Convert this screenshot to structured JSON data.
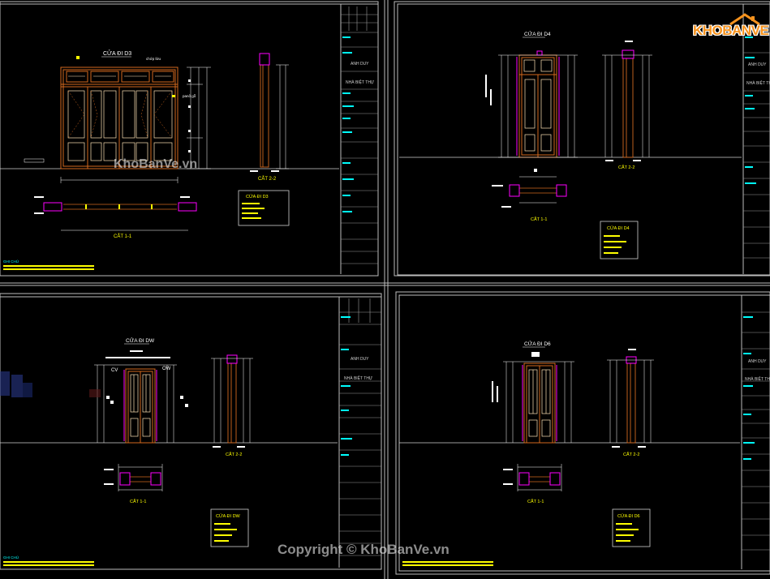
{
  "watermark": {
    "logo_text": "KHOBANVE",
    "center_text": "KhoBanVe.vn",
    "copyright_text": "Copyright © KhoBanVe.vn"
  },
  "title_block": {
    "owner": "ANH DUY",
    "project": "NHÀ BIỆT THỰ"
  },
  "sheets": [
    {
      "id": "d3",
      "door_title": "CỬA ĐI D3",
      "label_top": "chớp lửu",
      "label_side": "panô gỗ",
      "section_a": "CẮT 1-1",
      "section_b": "CẮT 2-2",
      "legend_title": "CỬA ĐI D3",
      "note": "GHI CHÚ"
    },
    {
      "id": "d4",
      "door_title": "CỬA ĐI D4",
      "section_a": "CẮT 1-1",
      "section_b": "CẮT 2-2",
      "legend_title": "CỬA ĐI D4"
    },
    {
      "id": "dw",
      "door_title": "CỬA ĐI DW",
      "label_left": "CV",
      "label_right": "OW",
      "section_a": "CẮT 1-1",
      "section_b": "CẮT 2-2",
      "legend_title": "CỬA ĐI DW",
      "note": "GHI CHÚ"
    },
    {
      "id": "d6",
      "door_title": "CỬA ĐI D6",
      "section_a": "CẮT 1-1",
      "section_b": "CẮT 2-2",
      "legend_title": "CỬA ĐI D6"
    }
  ],
  "colors": {
    "frame": "#c8c8c8",
    "door": "#d2691e",
    "panel": "#ffe4b5",
    "dim": "#ffffff",
    "magenta": "#ff00ff",
    "yellow": "#ffff00",
    "cyan": "#00ffff"
  }
}
